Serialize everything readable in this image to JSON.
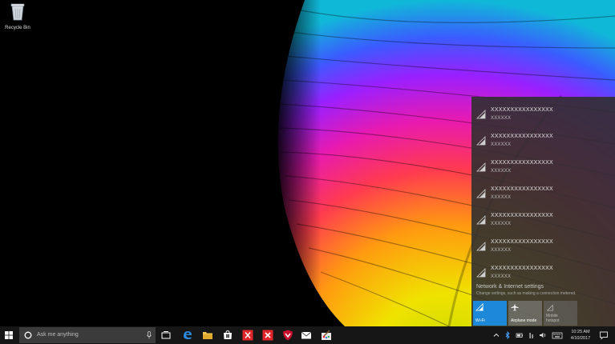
{
  "desktop": {
    "recycle_bin_label": "Recycle Bin"
  },
  "network_flyout": {
    "networks": [
      {
        "name": "XXXXXXXXXXXXXXXX",
        "detail": "XXXXXX"
      },
      {
        "name": "XXXXXXXXXXXXXXXX",
        "detail": "XXXXXX"
      },
      {
        "name": "XXXXXXXXXXXXXXXX",
        "detail": "XXXXXX"
      },
      {
        "name": "XXXXXXXXXXXXXXXX",
        "detail": "XXXXXX"
      },
      {
        "name": "XXXXXXXXXXXXXXXX",
        "detail": "XXXXXX"
      },
      {
        "name": "XXXXXXXXXXXXXXXX",
        "detail": "XXXXXX"
      },
      {
        "name": "XXXXXXXXXXXXXXXX",
        "detail": "XXXXXX"
      }
    ],
    "settings_link": "Network & Internet settings",
    "settings_description": "Change settings, such as making a connection metered.",
    "quick_actions": {
      "wifi": "Wi-Fi",
      "airplane": "Airplane mode",
      "hotspot_line1": "Mobile",
      "hotspot_line2": "hotspot"
    },
    "colors": {
      "accent": "#1e88d8",
      "background": "#303030"
    }
  },
  "taskbar": {
    "search_placeholder": "Ask me anything",
    "clock_time": "10:25 AM",
    "clock_date": "4/10/2017",
    "app_icons": [
      "edge-icon",
      "file-explorer-icon",
      "store-icon",
      "red-app-icon",
      "red-app-icon",
      "antivirus-icon",
      "mail-icon",
      "paint-icon"
    ],
    "tray_icons": [
      "chevron-up-icon",
      "bluetooth-icon",
      "battery-icon",
      "network-icon",
      "volume-icon",
      "keyboard-icon"
    ]
  }
}
